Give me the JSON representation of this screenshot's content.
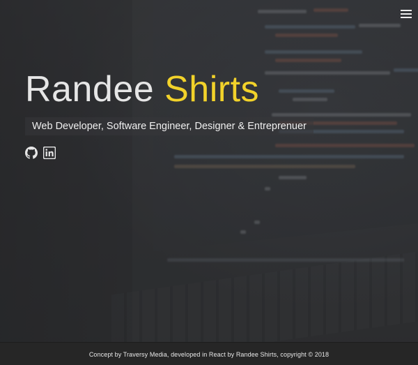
{
  "nav": {
    "menu_icon": "hamburger-menu-icon"
  },
  "hero": {
    "first_name": "Randee",
    "last_name": "Shirts",
    "tagline": "Web Developer, Software Engineer, Designer & Entreprenuer",
    "social": [
      {
        "icon": "github-icon"
      },
      {
        "icon": "linkedin-icon"
      }
    ]
  },
  "footer": {
    "text": "Concept by Traversy Media, developed in React by Randee Shirts, copyright © 2018"
  },
  "colors": {
    "accent": "#f2d22a",
    "text": "#e6e6e6",
    "footer_bg": "#262626"
  }
}
